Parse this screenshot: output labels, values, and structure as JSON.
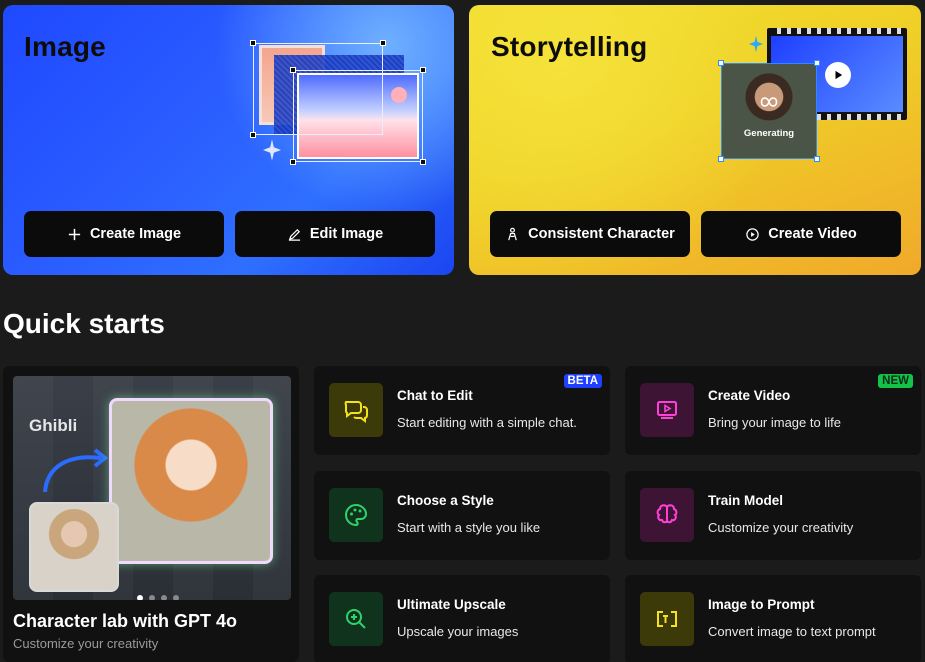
{
  "hero_image": {
    "title": "Image",
    "create_label": "Create Image",
    "edit_label": "Edit Image"
  },
  "hero_story": {
    "title": "Storytelling",
    "generating_label": "Generating",
    "character_label": "Consistent Character",
    "video_label": "Create Video"
  },
  "quick_starts": {
    "title": "Quick starts",
    "feature": {
      "overlay_text": "Ghibli",
      "title": "Character lab with GPT 4o",
      "subtitle": "Customize your creativity",
      "slides": 4,
      "active_slide": 1
    },
    "cards": [
      {
        "title": "Chat to Edit",
        "subtitle": "Start editing with a simple chat.",
        "badge": "BETA",
        "icon": "chat-bubbles-icon"
      },
      {
        "title": "Create Video",
        "subtitle": "Bring your image to life",
        "badge": "NEW",
        "icon": "video-play-icon"
      },
      {
        "title": "Choose a Style",
        "subtitle": "Start with a style you like",
        "badge": "",
        "icon": "palette-icon"
      },
      {
        "title": "Train Model",
        "subtitle": "Customize your creativity",
        "badge": "",
        "icon": "brain-icon"
      },
      {
        "title": "Ultimate Upscale",
        "subtitle": "Upscale your images",
        "badge": "",
        "icon": "zoom-in-icon"
      },
      {
        "title": "Image to Prompt",
        "subtitle": "Convert image to text prompt",
        "badge": "",
        "icon": "image-to-text-icon"
      }
    ]
  },
  "colors": {
    "yellow_accent": "#f5e11c",
    "green_accent": "#2fd36a",
    "pink_accent": "#ff3fd6",
    "beta_badge": "#1f40ff",
    "new_badge": "#12c24a"
  }
}
